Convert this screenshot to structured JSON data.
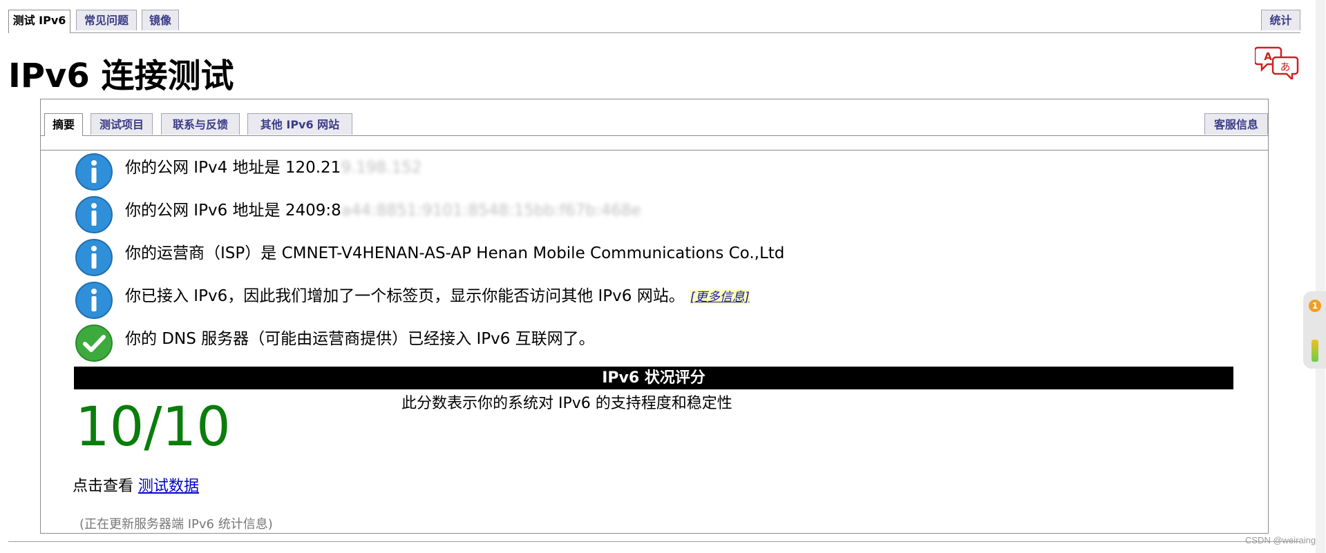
{
  "top_tabs": {
    "test": "测试 IPv6",
    "faq": "常见问题",
    "mirror": "镜像",
    "stats": "统计"
  },
  "page_title": "IPv6 连接测试",
  "inner_tabs": {
    "summary": "摘要",
    "tests": "测试项目",
    "contact": "联系与反馈",
    "other_sites": "其他 IPv6 网站",
    "helpdesk": "客服信息"
  },
  "rows": [
    {
      "icon": "info-icon",
      "text": "你的公网 IPv4 地址是 120.21",
      "blurred": "9.198.152"
    },
    {
      "icon": "info-icon",
      "text": "你的公网 IPv6 地址是 2409:8",
      "blurred": "a44:8851:9101:8548:15bb:f67b:468e"
    },
    {
      "icon": "info-icon",
      "text": "你的运营商（ISP）是 CMNET-V4HENAN-AS-AP Henan Mobile Communications Co.,Ltd"
    },
    {
      "icon": "info-icon",
      "text": "你已接入 IPv6，因此我们增加了一个标签页，显示你能否访问其他 IPv6 网站。",
      "link": "[更多信息]"
    },
    {
      "icon": "check-icon",
      "text": "你的 DNS 服务器（可能由运营商提供）已经接入 IPv6 互联网了。"
    }
  ],
  "score": {
    "header": "IPv6 状况评分",
    "value": "10/10",
    "description": "此分数表示你的系统对 IPv6 的支持程度和稳定性"
  },
  "view_data": {
    "prefix": "点击查看 ",
    "link": "测试数据"
  },
  "updating": "(正在更新服务器端 IPv6 统计信息)",
  "side_widget": {
    "badge": "1"
  },
  "watermark": "CSDN @weiraing",
  "colors": {
    "score_green": "#0a7d0a",
    "tab_text": "#3b3b87",
    "info_blue": "#2f8fd8",
    "check_green": "#3daa3d"
  }
}
